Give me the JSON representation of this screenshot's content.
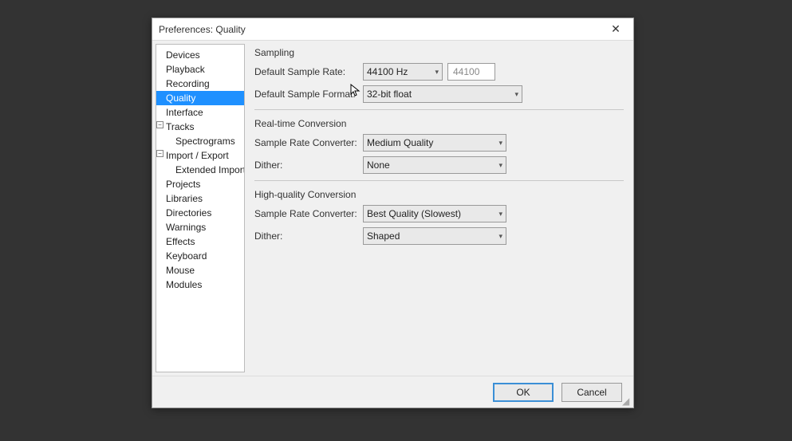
{
  "window": {
    "title": "Preferences: Quality",
    "close_glyph": "✕"
  },
  "tree": {
    "items": [
      {
        "label": "Devices",
        "level": 0,
        "selected": false,
        "expander": ""
      },
      {
        "label": "Playback",
        "level": 0,
        "selected": false,
        "expander": ""
      },
      {
        "label": "Recording",
        "level": 0,
        "selected": false,
        "expander": ""
      },
      {
        "label": "Quality",
        "level": 0,
        "selected": true,
        "expander": ""
      },
      {
        "label": "Interface",
        "level": 0,
        "selected": false,
        "expander": ""
      },
      {
        "label": "Tracks",
        "level": 0,
        "selected": false,
        "expander": "−"
      },
      {
        "label": "Spectrograms",
        "level": 1,
        "selected": false,
        "expander": ""
      },
      {
        "label": "Import / Export",
        "level": 0,
        "selected": false,
        "expander": "−"
      },
      {
        "label": "Extended Import",
        "level": 1,
        "selected": false,
        "expander": ""
      },
      {
        "label": "Projects",
        "level": 0,
        "selected": false,
        "expander": ""
      },
      {
        "label": "Libraries",
        "level": 0,
        "selected": false,
        "expander": ""
      },
      {
        "label": "Directories",
        "level": 0,
        "selected": false,
        "expander": ""
      },
      {
        "label": "Warnings",
        "level": 0,
        "selected": false,
        "expander": ""
      },
      {
        "label": "Effects",
        "level": 0,
        "selected": false,
        "expander": ""
      },
      {
        "label": "Keyboard",
        "level": 0,
        "selected": false,
        "expander": ""
      },
      {
        "label": "Mouse",
        "level": 0,
        "selected": false,
        "expander": ""
      },
      {
        "label": "Modules",
        "level": 0,
        "selected": false,
        "expander": ""
      }
    ]
  },
  "panel": {
    "sampling": {
      "title": "Sampling",
      "rate_label": "Default Sample Rate:",
      "rate_value": "44100 Hz",
      "rate_custom": "44100",
      "format_label": "Default Sample Format:",
      "format_value": "32-bit float"
    },
    "realtime": {
      "title": "Real-time Conversion",
      "converter_label": "Sample Rate Converter:",
      "converter_value": "Medium Quality",
      "dither_label": "Dither:",
      "dither_value": "None"
    },
    "highquality": {
      "title": "High-quality Conversion",
      "converter_label": "Sample Rate Converter:",
      "converter_value": "Best Quality (Slowest)",
      "dither_label": "Dither:",
      "dither_value": "Shaped"
    }
  },
  "footer": {
    "ok": "OK",
    "cancel": "Cancel"
  }
}
